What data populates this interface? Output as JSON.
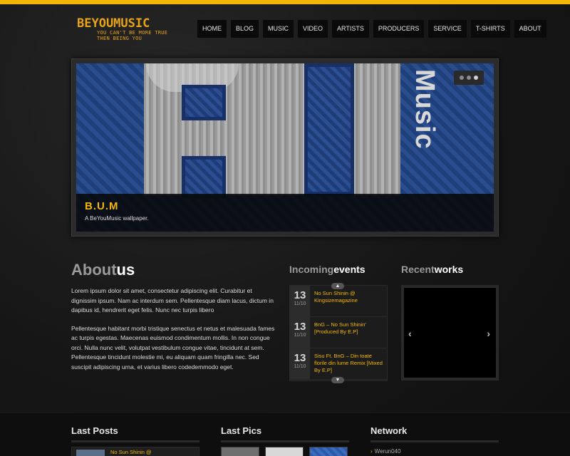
{
  "header": {
    "logo_title": "BEYOUMUSIC",
    "logo_tagline_1": "YOU CAN'T BE MORE TRUE",
    "logo_tagline_2": "THEN BEING YOU",
    "nav": [
      "HOME",
      "BLOG",
      "MUSIC",
      "VIDEO",
      "ARTISTS",
      "PRODUCERS",
      "SERVICE",
      "T-SHIRTS",
      "ABOUT"
    ]
  },
  "slider": {
    "graphic_word": "Music",
    "caption_title": "B.U.M",
    "caption_text": "A BeYouMusic wallpaper.",
    "active_dot": 2,
    "dot_count": 3
  },
  "about": {
    "title_plain": "About",
    "title_em": "us",
    "paragraph_1": "Lorem ipsum dolor sit amet, consectetur adipiscing elit. Curabitur et dignissim ipsum. Nam ac interdum sem. Pellentesque diam lacus, dictum in dapibus id, hendrerit eget felis. Nunc nec turpis libero",
    "paragraph_2": "Pellentesque habitant morbi tristique senectus et netus et malesuada fames ac turpis egestas. Maecenas euismod condimentum mollis. In non congue orci. Nulla nunc velit, volutpat vestibulum congue vitae, tincidunt at sem. Pellentesque tincidunt molestie mi, eu aliquam quam fringilla nec. Sed suscipit adipiscing urna, et varius libero codedemmodo eget."
  },
  "events": {
    "title_plain": "Incoming",
    "title_em": "events",
    "items": [
      {
        "day": "13",
        "month": "11/10",
        "title": "No Sun Shinin @ Kingsizemagazine"
      },
      {
        "day": "13",
        "month": "11/10",
        "title": "BnG – No Sun Shinin' [Produced By E.P]"
      },
      {
        "day": "13",
        "month": "11/10",
        "title": "Sisu Ft. BnG – Din toate florile din lume Remix [Mixed By E.P]"
      }
    ],
    "arrow_up": "▲",
    "arrow_down": "▼"
  },
  "works": {
    "title_plain": "Recent",
    "title_em": "works",
    "prev": "‹",
    "next": "›"
  },
  "footer": {
    "last_posts_title": "Last Posts",
    "last_post_text": "No Sun Shinin @",
    "last_pics_title": "Last Pics",
    "network_title": "Network",
    "network_item": "Werun040"
  },
  "colors": {
    "accent": "#f2b705",
    "background": "#141414"
  }
}
